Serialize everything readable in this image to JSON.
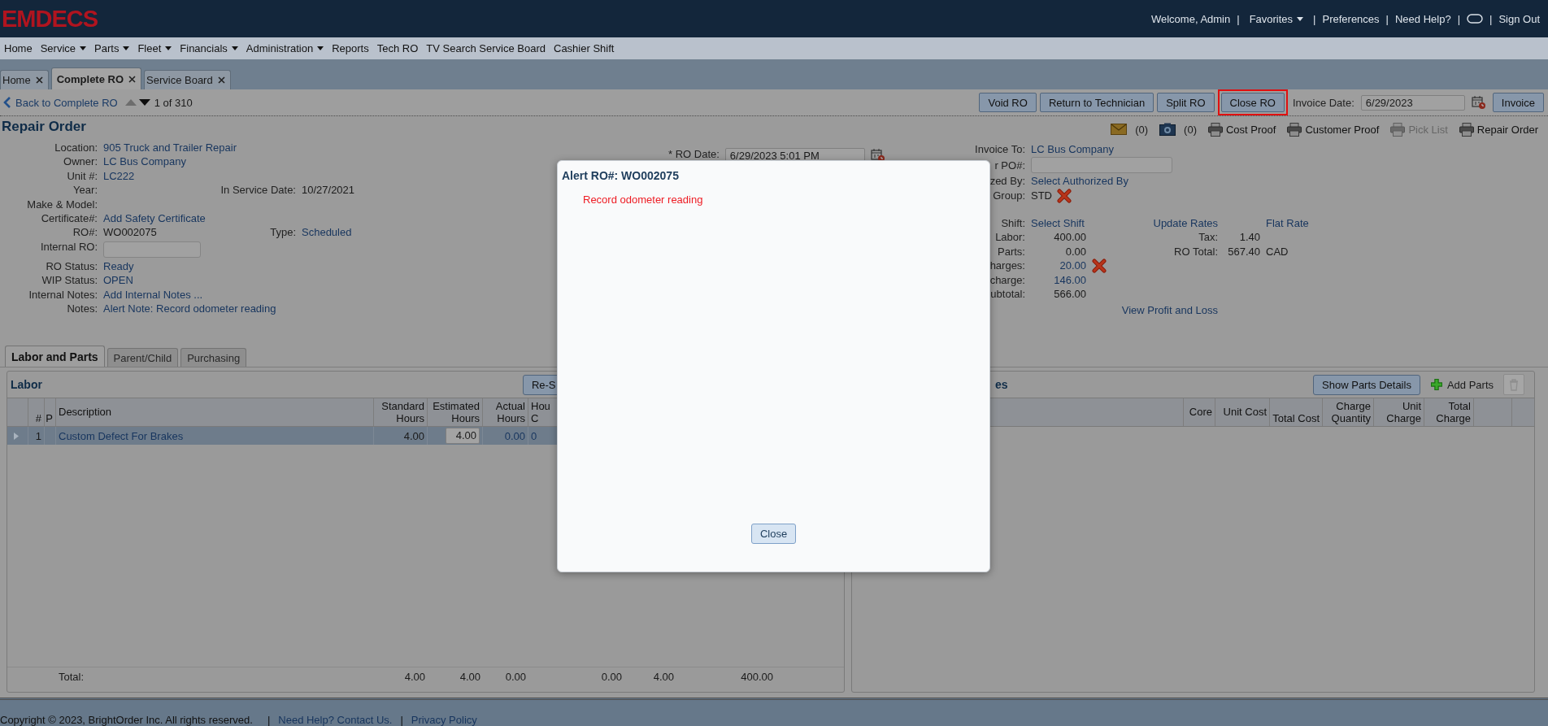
{
  "header": {
    "logo": "EMDECS",
    "links": [
      {
        "kind": "text",
        "text": "Welcome, Admin"
      },
      {
        "kind": "sep",
        "text": "|"
      },
      {
        "kind": "menu",
        "text": "Favorites"
      },
      {
        "kind": "sep",
        "text": "|"
      },
      {
        "kind": "link",
        "text": "Preferences"
      },
      {
        "kind": "sep",
        "text": "|"
      },
      {
        "kind": "link",
        "text": "Need Help?"
      },
      {
        "kind": "sep",
        "text": "|"
      },
      {
        "kind": "chat"
      },
      {
        "kind": "sep",
        "text": "|"
      },
      {
        "kind": "link",
        "text": "Sign Out"
      }
    ]
  },
  "nav": [
    {
      "label": "Home",
      "menu": false
    },
    {
      "label": "Service",
      "menu": true
    },
    {
      "label": "Parts",
      "menu": true
    },
    {
      "label": "Fleet",
      "menu": true
    },
    {
      "label": "Financials",
      "menu": true
    },
    {
      "label": "Administration",
      "menu": true
    },
    {
      "label": "Reports",
      "menu": false
    },
    {
      "label": "Tech RO",
      "menu": false
    },
    {
      "label": "TV Search Service Board",
      "menu": false
    },
    {
      "label": "Cashier Shift",
      "menu": false
    }
  ],
  "doc_tabs": [
    {
      "label": "Home",
      "selected": false
    },
    {
      "label": "Complete RO",
      "selected": true
    },
    {
      "label": "Service Board",
      "selected": false
    }
  ],
  "toolbar": {
    "back": "Back to Complete RO",
    "counter": "1 of 310",
    "buttons": [
      {
        "label": "Void RO",
        "highlighted": false
      },
      {
        "label": "Return to Technician",
        "highlighted": false
      },
      {
        "label": "Split RO",
        "highlighted": false
      },
      {
        "label": "Close RO",
        "highlighted": true
      }
    ],
    "invoice_date_label": "Invoice Date:",
    "invoice_date": "6/29/2023",
    "invoice_button": "Invoice"
  },
  "repair_order": {
    "title": "Repair Order",
    "actions": [
      {
        "kind": "mail",
        "label": "(0)",
        "disabled": false
      },
      {
        "kind": "camera",
        "label": "(0)",
        "disabled": false
      },
      {
        "kind": "print",
        "label": "Cost Proof",
        "disabled": false
      },
      {
        "kind": "print",
        "label": "Customer Proof",
        "disabled": false
      },
      {
        "kind": "print",
        "label": "Pick List",
        "disabled": true
      },
      {
        "kind": "print",
        "label": "Repair Order",
        "disabled": false
      }
    ],
    "fields": [
      {
        "label": "Location:",
        "kind": "link",
        "value": "905 Truck and Trailer Repair"
      },
      {
        "label": "Owner:",
        "kind": "link",
        "value": "LC Bus Company"
      },
      {
        "label": "Unit #:",
        "kind": "link",
        "value": "LC222"
      },
      {
        "label": "Year:",
        "kind": "empty",
        "extra": {
          "label": "In Service Date:",
          "kind": "text",
          "value": "10/27/2021"
        }
      },
      {
        "label": "Make & Model:",
        "kind": "empty"
      },
      {
        "label": "Certificate#:",
        "kind": "link",
        "value": "Add Safety Certificate"
      },
      {
        "label": "RO#:",
        "kind": "text",
        "value": "WO002075",
        "extra": {
          "label": "Type:",
          "kind": "link",
          "value": "Scheduled"
        }
      },
      {
        "label": "Internal RO:",
        "kind": "input"
      },
      {
        "label": "RO Status:",
        "kind": "link",
        "value": "Ready"
      },
      {
        "label": "WIP Status:",
        "kind": "link",
        "value": "OPEN"
      },
      {
        "label": "Internal Notes:",
        "kind": "link",
        "value": "Add Internal Notes ..."
      },
      {
        "label": "Notes:",
        "kind": "link",
        "value": "Alert Note: Record odometer reading"
      }
    ],
    "ro_date": {
      "label": "* RO Date:",
      "value": "6/29/2023 5:01 PM"
    },
    "billing": [
      {
        "label": "Invoice To:",
        "kind": "link",
        "value": "LC Bus Company",
        "removable": false
      },
      {
        "label": "r PO#:",
        "kind": "input",
        "removable": false
      },
      {
        "label": "zed By:",
        "kind": "link",
        "value": "Select Authorized By",
        "removable": false
      },
      {
        "label": "Group:",
        "kind": "text",
        "value": "STD",
        "removable": true
      }
    ],
    "totals": [
      {
        "label": "Shift:",
        "kind": "link",
        "value": "Select Shift",
        "removable": false
      },
      {
        "label": "Labor:",
        "kind": "number",
        "value": "400.00",
        "removable": false
      },
      {
        "label": "Parts:",
        "kind": "number",
        "value": "0.00",
        "removable": false
      },
      {
        "label": "harges:",
        "kind": "link-number",
        "value": "20.00",
        "removable": true
      },
      {
        "label": "charge:",
        "kind": "link-number",
        "value": "146.00",
        "removable": false
      },
      {
        "label": "ubtotal:",
        "kind": "number",
        "value": "566.00",
        "removable": false
      }
    ],
    "rates": {
      "update": "Update Rates",
      "flat": "Flat Rate",
      "rows": [
        {
          "label": "Tax:",
          "value": "1.40"
        },
        {
          "label": "RO Total:",
          "value": "567.40",
          "unit": "CAD"
        }
      ]
    },
    "profit_loss": "View Profit and Loss"
  },
  "section_tabs": [
    {
      "label": "Labor and Parts",
      "selected": true
    },
    {
      "label": "Parent/Child",
      "selected": false
    },
    {
      "label": "Purchasing",
      "selected": false
    }
  ],
  "labor": {
    "title": "Labor",
    "button": "Re-S",
    "columns": [
      "#",
      "P",
      "Description",
      "Standard Hours",
      "Estimated Hours",
      "Actual Hours",
      "Hou C"
    ],
    "rows": [
      {
        "no": "1",
        "description": "Custom Defect For Brakes",
        "standard": "4.00",
        "estimated": "4.00",
        "actual": "0.00",
        "column_7": "0",
        "selected": true
      }
    ],
    "totals": {
      "label": "Total:",
      "standard": "4.00",
      "estimated": "4.00",
      "actual": "0.00",
      "column_8": "0.00",
      "column_9": "4.00",
      "column_10": "400.00"
    }
  },
  "parts": {
    "title": "es",
    "button": "Show Parts Details",
    "add": "Add Parts",
    "delete_disabled": true,
    "columns": [
      "Core",
      "Unit Cost",
      "Total Cost",
      "Charge Quantity",
      "Unit Charge",
      "Total Charge"
    ]
  },
  "dialog": {
    "title": "Alert RO#: WO002075",
    "message": "Record odometer reading",
    "button": "Close"
  },
  "footer": [
    {
      "kind": "text",
      "text": "Copyright © 2023, BrightOrder Inc. All rights reserved."
    },
    {
      "kind": "sep",
      "text": "|"
    },
    {
      "kind": "link",
      "text": "Need Help? Contact Us."
    },
    {
      "kind": "sep",
      "text": "|"
    },
    {
      "kind": "link",
      "text": "Privacy Policy"
    }
  ]
}
